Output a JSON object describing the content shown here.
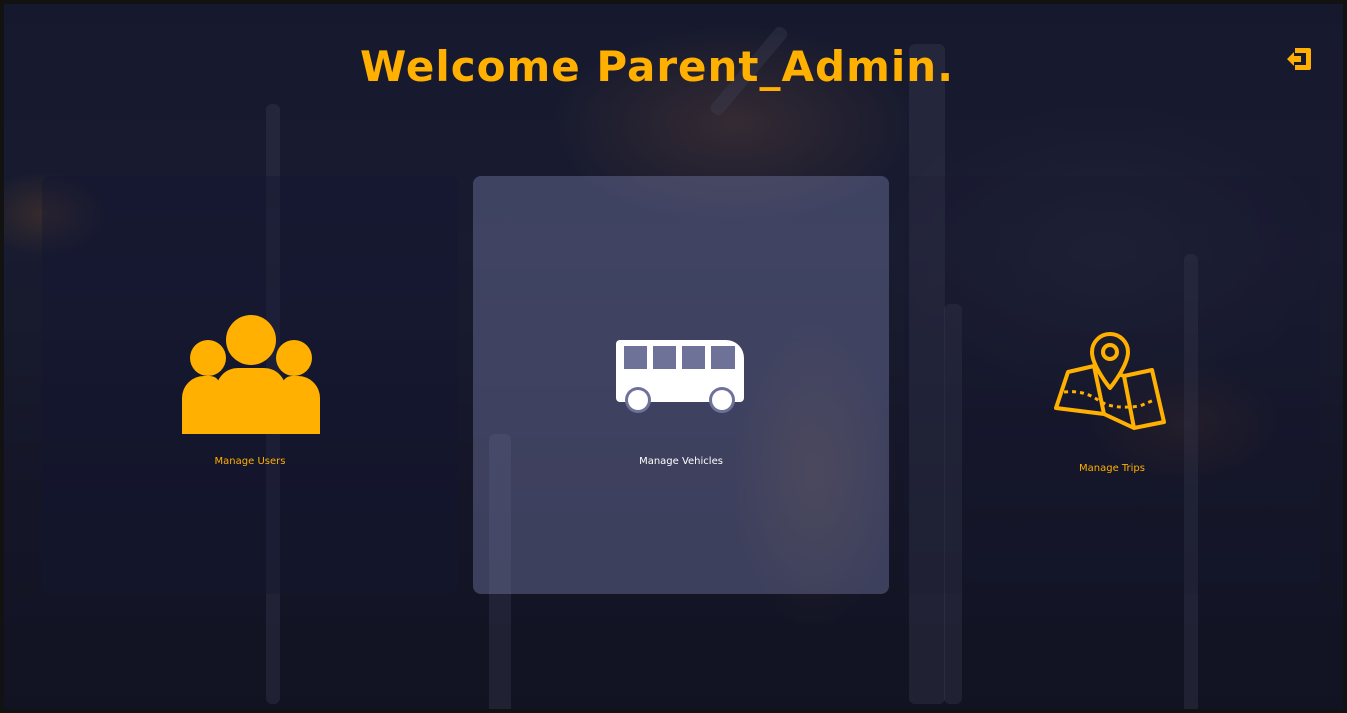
{
  "header": {
    "welcome_text": "Welcome Parent_Admin.",
    "logout_icon": "logout-icon"
  },
  "cards": [
    {
      "label": "Manage Users",
      "icon": "users-icon",
      "color": "#ffb000"
    },
    {
      "label": "Manage Vehicles",
      "icon": "bus-icon",
      "color": "#ffffff"
    },
    {
      "label": "Manage Trips",
      "icon": "map-pin-icon",
      "color": "#ffb000"
    }
  ],
  "colors": {
    "accent": "#ffb000",
    "overlay": "#0d1228"
  }
}
